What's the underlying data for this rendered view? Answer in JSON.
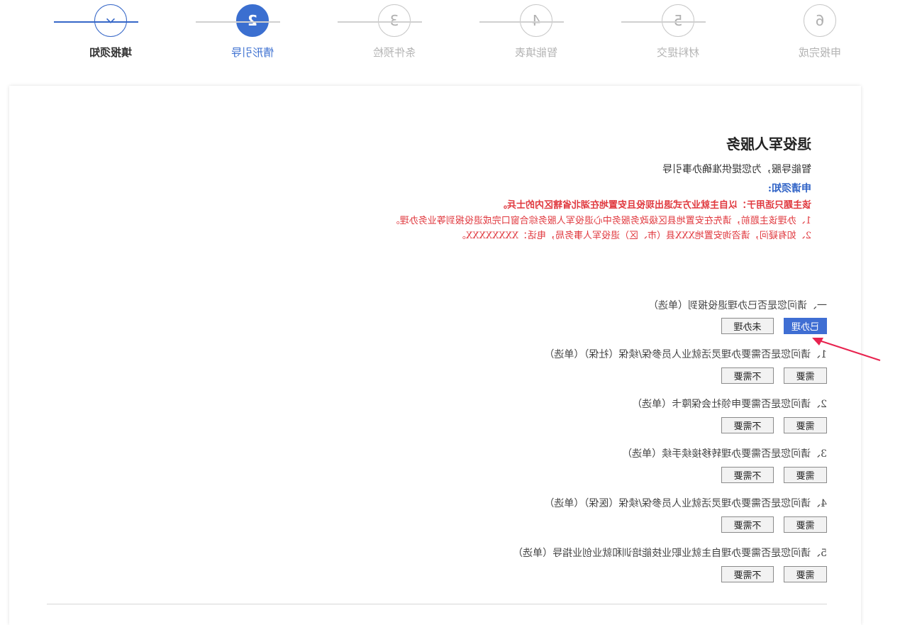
{
  "steps": [
    {
      "label": "填报须知",
      "state": "done",
      "icon": "check-icon"
    },
    {
      "label": "情形引导",
      "number": "2",
      "state": "active"
    },
    {
      "label": "条件预检",
      "number": "3",
      "state": "pending"
    },
    {
      "label": "智能填表",
      "number": "4",
      "state": "pending"
    },
    {
      "label": "材料提交",
      "number": "5",
      "state": "pending"
    },
    {
      "label": "申报完成",
      "number": "6",
      "state": "pending"
    }
  ],
  "page": {
    "title": "退役军人服务",
    "subtitle": "智能导服，为您提供准确办事引导",
    "notice_heading": "申请须知:",
    "notice_lines": [
      "该主题只适用于：以自主就业方式退出现役且安置地在湖北省辖区内的士兵。",
      "1、办理该主题前，请先在安置地县区级政务服务中心退役军人服务综合窗口完成退役报到等业务办理。",
      "2、如有疑问，请咨询安置地XXX县（市、区）退役军人事务局，电话：XXXXXXXX。"
    ]
  },
  "questions": [
    {
      "text": "一、请问您是否已办理退役报到（单选）",
      "options": [
        "已办理",
        "未办理"
      ],
      "selected": 0
    },
    {
      "text": "1、请问您是否需要办理灵活就业人员参保/续保（社保）（单选）",
      "options": [
        "需要",
        "不需要"
      ],
      "selected": null
    },
    {
      "text": "2、请问您是否需要申领社会保障卡（单选）",
      "options": [
        "需要",
        "不需要"
      ],
      "selected": null
    },
    {
      "text": "3、请问您是否需要办理转移接续手续（单选）",
      "options": [
        "需要",
        "不需要"
      ],
      "selected": null
    },
    {
      "text": "4、请问您是否需要办理灵活就业人员参保/续保（医保）（单选）",
      "options": [
        "需要",
        "不需要"
      ],
      "selected": null
    },
    {
      "text": "5、请问您是否需要办理自主就业职业技能培训和就业创业指导（单选）",
      "options": [
        "需要",
        "不需要"
      ],
      "selected": null
    }
  ],
  "colors": {
    "accent": "#3b6fd0",
    "notice_red": "#e0383e",
    "annotation_arrow": "#e8234f"
  }
}
